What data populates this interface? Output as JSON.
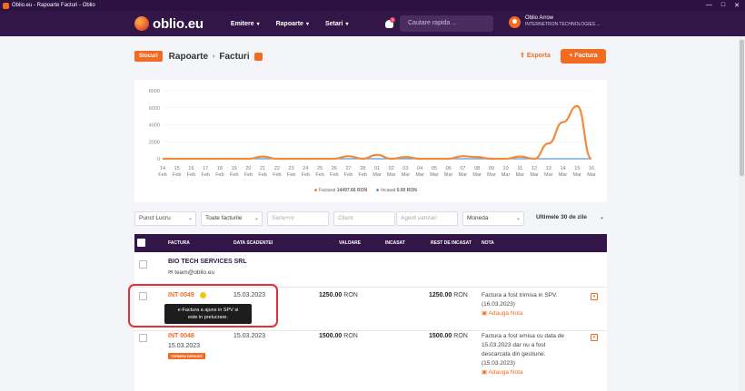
{
  "window": {
    "title": "Oblio.eu - Rapoarte Facturi - Oblio",
    "controls": [
      "—",
      "□",
      "✕"
    ]
  },
  "brand": {
    "logo_text": "oblio.eu"
  },
  "menu": [
    {
      "label": "Emitere"
    },
    {
      "label": "Rapoarte"
    },
    {
      "label": "Setari"
    }
  ],
  "notifications": {
    "count": "1"
  },
  "search": {
    "placeholder": "Cautare rapida ..."
  },
  "user": {
    "name": "Oblio Arrow",
    "company": "INTERNETRON TECHNOLOGIES ..."
  },
  "header": {
    "badge": "Stocuri",
    "crumb1": "Rapoarte",
    "crumb2": "Facturi",
    "export_label": "Exporta",
    "new_label": "Factura"
  },
  "chart_data": {
    "type": "line",
    "x": [
      "14 Feb",
      "15 Feb",
      "16 Feb",
      "17 Feb",
      "18 Feb",
      "19 Feb",
      "20 Feb",
      "21 Feb",
      "22 Feb",
      "23 Feb",
      "24 Feb",
      "25 Feb",
      "26 Feb",
      "27 Feb",
      "28 Feb",
      "01 Mar",
      "02 Mar",
      "03 Mar",
      "04 Mar",
      "05 Mar",
      "06 Mar",
      "07 Mar",
      "08 Mar",
      "09 Mar",
      "10 Mar",
      "11 Mar",
      "12 Mar",
      "13 Mar",
      "14 Mar",
      "15 Mar",
      "16 Mar"
    ],
    "x_days": [
      "14",
      "15",
      "16",
      "17",
      "18",
      "19",
      "20",
      "21",
      "22",
      "23",
      "24",
      "25",
      "26",
      "27",
      "28",
      "01",
      "02",
      "03",
      "04",
      "05",
      "06",
      "07",
      "08",
      "09",
      "10",
      "11",
      "12",
      "13",
      "14",
      "15",
      "16"
    ],
    "x_months": [
      "Feb",
      "Feb",
      "Feb",
      "Feb",
      "Feb",
      "Feb",
      "Feb",
      "Feb",
      "Feb",
      "Feb",
      "Feb",
      "Feb",
      "Feb",
      "Feb",
      "Feb",
      "Mar",
      "Mar",
      "Mar",
      "Mar",
      "Mar",
      "Mar",
      "Mar",
      "Mar",
      "Mar",
      "Mar",
      "Mar",
      "Mar",
      "Mar",
      "Mar",
      "Mar",
      "Mar"
    ],
    "series": [
      {
        "name": "Facturat",
        "total": "14497.66 RON",
        "color": "#f28a3c",
        "values": [
          0,
          0,
          0,
          0,
          0,
          0,
          0,
          250,
          0,
          0,
          0,
          0,
          0,
          300,
          0,
          450,
          0,
          200,
          0,
          0,
          0,
          300,
          200,
          0,
          0,
          250,
          0,
          1800,
          4300,
          6200,
          0
        ]
      },
      {
        "name": "Incasat",
        "total": "0.00 RON",
        "color": "#5b9bd5",
        "values": [
          0,
          0,
          0,
          0,
          0,
          0,
          0,
          0,
          0,
          0,
          0,
          0,
          0,
          0,
          0,
          0,
          0,
          0,
          0,
          0,
          0,
          0,
          0,
          0,
          0,
          0,
          0,
          0,
          0,
          0,
          0
        ]
      }
    ],
    "yticks": [
      "8000",
      "6000",
      "4000",
      "2000",
      "0"
    ],
    "ylim": [
      0,
      8000
    ],
    "grid": true,
    "legend": "bottom"
  },
  "filters": {
    "punct_lucru": "Punct Lucru",
    "toate_facturile": "Toate facturile",
    "serie_nr": "Serie+nr",
    "client": "Client",
    "agent": "Agent vanzari",
    "moneda": "Moneda",
    "perioada": "Ultimele 30 de zile"
  },
  "table": {
    "headers": {
      "factura": "FACTURA",
      "data": "DATA SCADENTEI",
      "valoare": "VALOARE",
      "incasat": "INCASAT",
      "rest": "REST DE INCASAT",
      "nota": "NOTA"
    },
    "client_group": {
      "name": "BIO TECH SERVICES SRL",
      "email": "team@oblio.eu"
    },
    "rows": [
      {
        "number": "INT 0049",
        "due": "15.03.2023",
        "value": "1250.00",
        "currency": "RON",
        "rest": "1250.00",
        "note": "Factura a fost trimisa in SPV. (16.03.2023)",
        "add_note": "Adauga Nota"
      },
      {
        "number": "INT 0048",
        "issued": "15.03.2023",
        "due": "15.03.2023",
        "value": "1500.00",
        "currency": "RON",
        "rest": "1500.00",
        "badge": "TERMEN DEPASIT",
        "note": "Factura a fost emisa cu data de 15.03.2023 dar nu a fost descarcata din gestiune. (15.03.2023)",
        "add_note": "Adauga Nota"
      }
    ]
  },
  "tooltip": {
    "line1": "e-Factura a ajuns in SPV si",
    "line2": "este in prelucrare."
  }
}
